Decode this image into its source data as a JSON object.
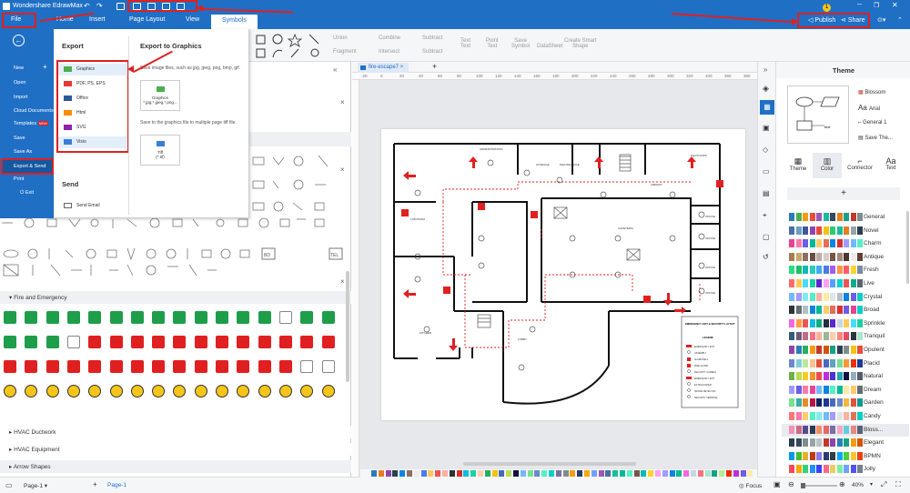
{
  "app": {
    "title": "Wondershare EdrawMax"
  },
  "ribbon": {
    "tabs": [
      "File",
      "Home",
      "Insert",
      "Page Layout",
      "View",
      "Symbols"
    ],
    "active": "Symbols",
    "publish_label": "Publish",
    "share_label": "Share",
    "badge": "1"
  },
  "toolbar": {
    "items": [
      "Union",
      "Combine",
      "Subtract",
      "Fragment",
      "Intersect",
      "Subtract",
      "Text",
      "Point",
      "Save",
      "DataSheet",
      "Create Smart"
    ],
    "sub": [
      "",
      "",
      "",
      "",
      "",
      "",
      "Text",
      "Text",
      "Symbol",
      "",
      "Shape"
    ]
  },
  "filemenu": {
    "items": [
      "New",
      "Open",
      "Import",
      "Cloud Documents",
      "Templates",
      "Save",
      "Save As",
      "Export & Send",
      "Print",
      "Exit"
    ],
    "templates_badge": "NEW"
  },
  "export": {
    "heading": "Export",
    "items": [
      "Graphics",
      "PDF, PS, EPS",
      "Office",
      "Html",
      "SVG",
      "Visio"
    ],
    "send_heading": "Send",
    "send_email": "Send Email",
    "graphics_heading": "Export to Graphics",
    "graphics_desc": "Save image files, such as jpg, jpeg, png, bmp, gif.",
    "graphics_btn": "Graphics",
    "graphics_btn_sub": "*.jpg,*.jpeg,*.png...",
    "tif_desc": "Save to the graphics file to multiple page tiff file.",
    "tif_btn": "Tiff",
    "tif_btn_sub": "(*.tif)"
  },
  "library": {
    "categories": [
      "Fire and Emergency",
      "HVAC Ductwork",
      "HVAC Equipment",
      "Arrow Shapes"
    ],
    "tags": [
      "BD",
      "TEL"
    ]
  },
  "canvas": {
    "tab": "fire-escape7",
    "ruler": [
      "-20",
      "0",
      "20",
      "40",
      "60",
      "80",
      "100",
      "120",
      "140",
      "160",
      "180",
      "200",
      "220",
      "240",
      "260",
      "280",
      "300",
      "320",
      "340",
      "360",
      "380",
      "400"
    ],
    "rooms": [
      "ADMINISTRATION",
      "STORAGE",
      "MAINTENANCE",
      "LIBRARY",
      "LAB ROOM",
      "PHOTO/OPS",
      "KITCHEN",
      "DINING ROOM",
      "CAFETERIA",
      "LOBBY",
      "OFFICE",
      "OFFICE",
      "OFFICE",
      "OFFICE"
    ],
    "legend_title": "EMERGENCY EXIT & SECURITY LAYOUT",
    "legend_sub": "LEGEND",
    "legend_items": [
      "EMERGENCY EXIT",
      "ASSEMBLY",
      "ALARM BELL",
      "FIRE ALARM",
      "SECURITY CAMERA",
      "EMERGENCY EXIT",
      "EXTINGUISHER",
      "SMOKE DETECTOR",
      "SECURITY TERMINAL"
    ]
  },
  "theme": {
    "title": "Theme",
    "preview": {
      "font": "Arial",
      "style": "Blossom",
      "general": "General 1",
      "save": "Save The..."
    },
    "tabs": [
      "Theme",
      "Color",
      "Connector",
      "Text"
    ],
    "active_tab": "Color",
    "palettes": [
      {
        "name": "General",
        "colors": [
          "#2c7bb6",
          "#4caf50",
          "#f39c12",
          "#e74c3c",
          "#9b59b6",
          "#1abc9c",
          "#34495e",
          "#e67e22",
          "#16a085",
          "#c0392b",
          "#7f8c8d"
        ]
      },
      {
        "name": "Novel",
        "colors": [
          "#4a6fa5",
          "#6d9dc5",
          "#3b5998",
          "#8e44ad",
          "#e74c3c",
          "#f1c40f",
          "#2ecc71",
          "#1abc9c",
          "#e67e22",
          "#95a5a6",
          "#2c3e50"
        ]
      },
      {
        "name": "Charm",
        "colors": [
          "#e84393",
          "#fd79a8",
          "#6c5ce7",
          "#00b894",
          "#fdcb6e",
          "#e17055",
          "#0984e3",
          "#d63031",
          "#a29bfe",
          "#74b9ff",
          "#55efc4"
        ]
      },
      {
        "name": "Antique",
        "colors": [
          "#a67c52",
          "#c9a66b",
          "#8d6e63",
          "#6d4c41",
          "#bcaaa4",
          "#d7ccc8",
          "#795548",
          "#a1887f",
          "#4e342e",
          "#efebe9",
          "#5d4037"
        ]
      },
      {
        "name": "Fresh",
        "colors": [
          "#26de81",
          "#20bf6b",
          "#0fb9b1",
          "#2bcbba",
          "#45aaf2",
          "#4b7bec",
          "#a55eea",
          "#fd9644",
          "#fc5c65",
          "#fed330",
          "#778ca3"
        ]
      },
      {
        "name": "Live",
        "colors": [
          "#ff6b6b",
          "#feca57",
          "#48dbfb",
          "#1dd1a1",
          "#5f27cd",
          "#ff9ff3",
          "#54a0ff",
          "#00d2d3",
          "#ee5253",
          "#10ac84",
          "#576574"
        ]
      },
      {
        "name": "Crystal",
        "colors": [
          "#74b9ff",
          "#a29bfe",
          "#81ecec",
          "#55efc4",
          "#fab1a0",
          "#ffeaa7",
          "#dfe6e9",
          "#b2bec3",
          "#0984e3",
          "#6c5ce7",
          "#00cec9"
        ]
      },
      {
        "name": "Broad",
        "colors": [
          "#2d3436",
          "#636e72",
          "#b2bec3",
          "#0984e3",
          "#00b894",
          "#fdcb6e",
          "#e17055",
          "#d63031",
          "#6c5ce7",
          "#e84393",
          "#00cec9"
        ]
      },
      {
        "name": "Sprinkle",
        "colors": [
          "#f368e0",
          "#ff9f43",
          "#ee5253",
          "#0abde3",
          "#10ac84",
          "#222f3e",
          "#5f27cd",
          "#c8d6e5",
          "#feca57",
          "#48dbfb",
          "#1dd1a1"
        ]
      },
      {
        "name": "Tranquil",
        "colors": [
          "#355c7d",
          "#6c5b7b",
          "#c06c84",
          "#f67280",
          "#f8b195",
          "#99b898",
          "#feceab",
          "#ff847c",
          "#e84a5f",
          "#2a363b",
          "#a8e6ce"
        ]
      },
      {
        "name": "Opulent",
        "colors": [
          "#8e44ad",
          "#2980b9",
          "#27ae60",
          "#f39c12",
          "#c0392b",
          "#d35400",
          "#16a085",
          "#2c3e50",
          "#7f8c8d",
          "#f1c40f",
          "#e74c3c"
        ]
      },
      {
        "name": "Placid",
        "colors": [
          "#6a89cc",
          "#82ccdd",
          "#b8e994",
          "#f8c291",
          "#e55039",
          "#4a69bd",
          "#60a3bc",
          "#78e08f",
          "#fa983a",
          "#eb2f06",
          "#1e3799"
        ]
      },
      {
        "name": "Natural",
        "colors": [
          "#6ab04c",
          "#badc58",
          "#f9ca24",
          "#f0932b",
          "#eb4d4b",
          "#be2edd",
          "#4834d4",
          "#22a6b3",
          "#130f40",
          "#95afc0",
          "#535c68"
        ]
      },
      {
        "name": "Dream",
        "colors": [
          "#a29bfe",
          "#6c5ce7",
          "#fd79a8",
          "#e84393",
          "#74b9ff",
          "#0984e3",
          "#55efc4",
          "#00b894",
          "#ffeaa7",
          "#fdcb6e",
          "#636e72"
        ]
      },
      {
        "name": "Garden",
        "colors": [
          "#78e08f",
          "#38ada9",
          "#e58e26",
          "#b71540",
          "#0c2461",
          "#1e3799",
          "#4a69bd",
          "#6a89cc",
          "#f6b93b",
          "#e55039",
          "#079992"
        ]
      },
      {
        "name": "Candy",
        "colors": [
          "#ff7675",
          "#fd79a8",
          "#fdcb6e",
          "#55efc4",
          "#81ecec",
          "#74b9ff",
          "#a29bfe",
          "#dfe6e9",
          "#fab1a0",
          "#e17055",
          "#00cec9"
        ]
      },
      {
        "name": "Bloss...",
        "colors": [
          "#f78fb3",
          "#cf6a87",
          "#574b90",
          "#303952",
          "#f19066",
          "#e66767",
          "#786fa6",
          "#f8a5c2",
          "#63cdda",
          "#ea8685",
          "#596275"
        ]
      },
      {
        "name": "Elegant",
        "colors": [
          "#2c3e50",
          "#34495e",
          "#7f8c8d",
          "#95a5a6",
          "#bdc3c7",
          "#c0392b",
          "#8e44ad",
          "#2980b9",
          "#16a085",
          "#f39c12",
          "#d35400"
        ]
      },
      {
        "name": "BPMN",
        "colors": [
          "#0097e6",
          "#44bd32",
          "#e1b12c",
          "#c23616",
          "#8c7ae6",
          "#273c75",
          "#353b48",
          "#00a8ff",
          "#4cd137",
          "#fbc531",
          "#e84118"
        ]
      },
      {
        "name": "Jolly",
        "colors": [
          "#ff4757",
          "#ffa502",
          "#2ed573",
          "#1e90ff",
          "#3742fa",
          "#ff6b81",
          "#eccc68",
          "#7bed9f",
          "#70a1ff",
          "#5352ed",
          "#747d8c"
        ]
      }
    ]
  },
  "status": {
    "page_label": "Page-1",
    "page_tab": "Page-1",
    "focus": "Focus",
    "zoom": "40%"
  },
  "colors": {
    "brand": "#1f6fc5",
    "accent_red": "#e02020"
  }
}
